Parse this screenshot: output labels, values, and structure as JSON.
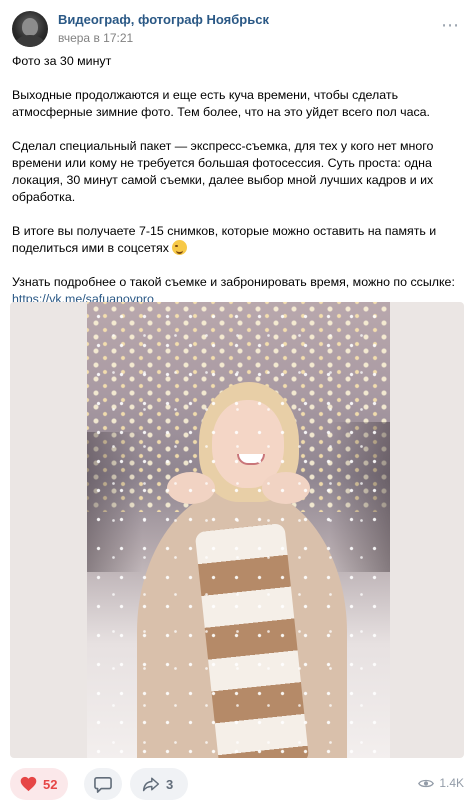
{
  "post": {
    "author": "Видеограф, фотограф Ноябрьск",
    "time": "вчера в 17:21",
    "more_icon": "more-horizontal-icon",
    "paragraphs": [
      "Фото за 30 минут",
      "Выходные продолжаются и еще есть куча времени, чтобы сделать атмосферные зимние фото. Тем более, что на это уйдет всего пол часа.",
      "Сделал специальный пакет — экспресс-съемка, для тех у кого нет много времени или кому не требуется большая фотосессия. Суть проста: одна локация, 30 минут самой съемки, далее выбор мной лучших кадров и их обработка.",
      "В итоге вы получаете 7-15 снимков, которые можно оставить на память и поделиться ими в соцсетях",
      "Узнать подробнее о такой съемке и забронировать время, можно по ссылке:"
    ],
    "emoji": "winking-face-emoji",
    "link": "https://vk.me/safuanovpro",
    "photo_alt": "winter-portrait-photo"
  },
  "actions": {
    "likes": "52",
    "shares": "3",
    "views": "1.4K",
    "like_color": "#e64646",
    "like_bg": "#fbe8ea",
    "icons": [
      "heart-icon",
      "comment-icon",
      "share-icon",
      "eye-icon"
    ]
  },
  "colors": {
    "link": "#2a5885",
    "meta": "#828282",
    "pill_bg": "#f0f2f5"
  }
}
